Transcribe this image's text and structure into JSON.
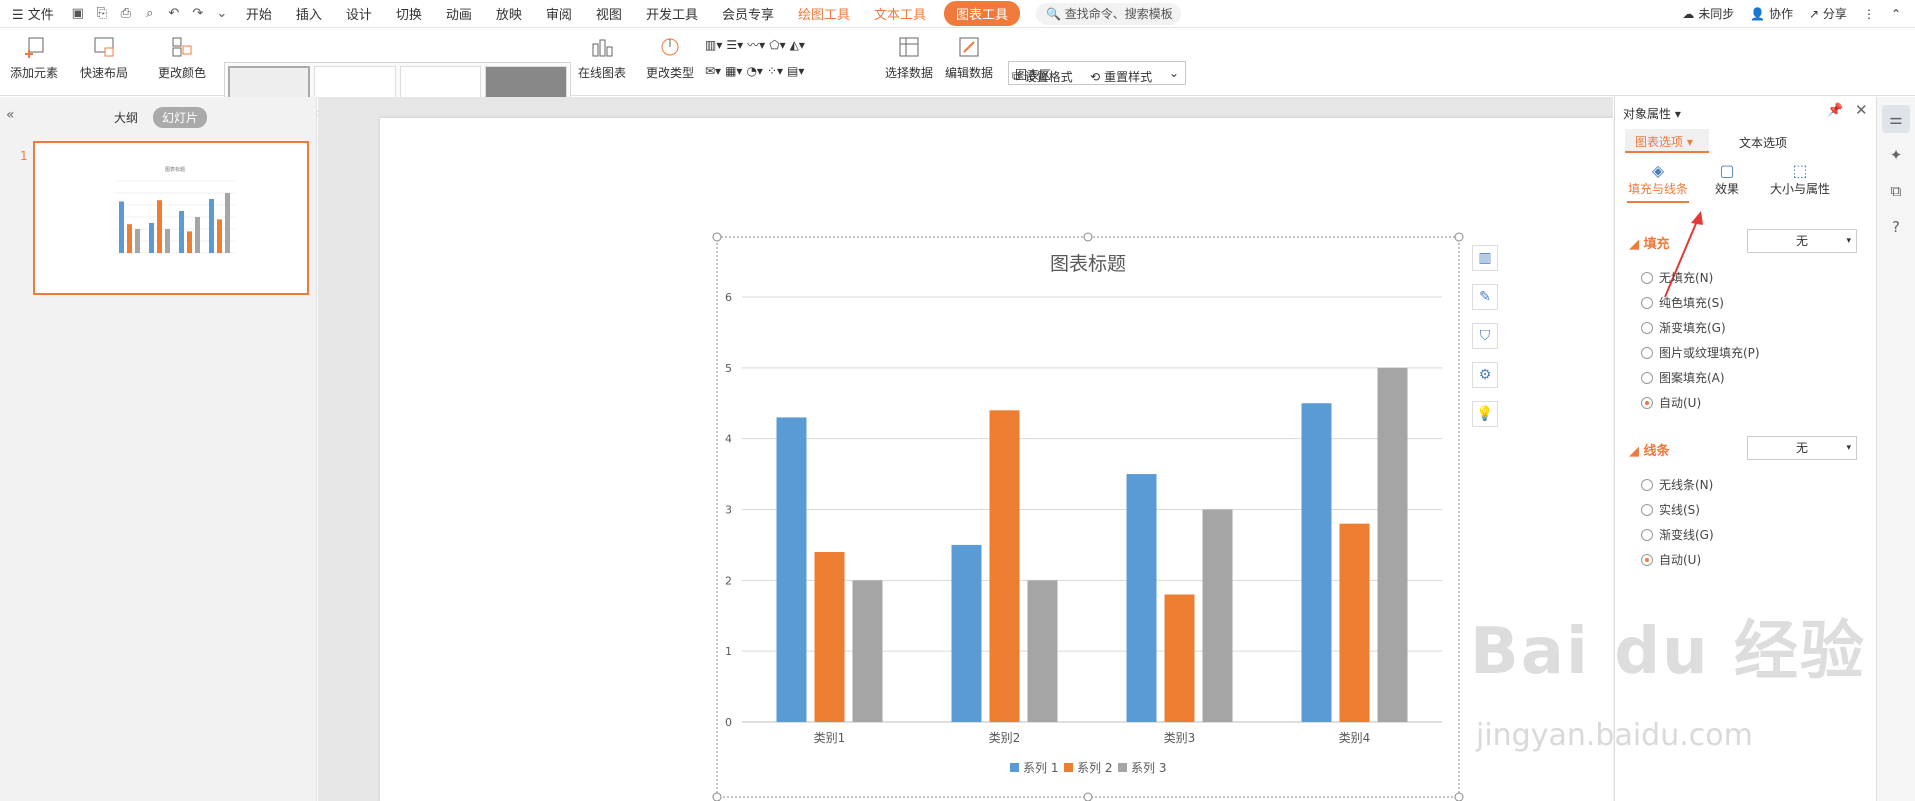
{
  "menu": {
    "file": "文件",
    "items": [
      "开始",
      "插入",
      "设计",
      "切换",
      "动画",
      "放映",
      "审阅",
      "视图",
      "开发工具",
      "会员专享"
    ],
    "context_tools": [
      "绘图工具",
      "文本工具"
    ],
    "active_tool": "图表工具",
    "search": "查找命令、搜索模板",
    "right": [
      "未同步",
      "协作",
      "分享"
    ]
  },
  "ribbon": {
    "add_element": "添加元素",
    "quick_layout": "快速布局",
    "change_color": "更改颜色",
    "online_chart": "在线图表",
    "change_type": "更改类型",
    "select_data": "选择数据",
    "edit_data": "编辑数据",
    "area_select": "图表区",
    "set_format": "设置格式",
    "reset_style": "重置样式"
  },
  "left": {
    "outline": "大纲",
    "slides": "幻灯片",
    "slide_number": "1"
  },
  "chart_data": {
    "type": "bar",
    "title": "图表标题",
    "categories": [
      "类别1",
      "类别2",
      "类别3",
      "类别4"
    ],
    "series": [
      {
        "name": "系列 1",
        "values": [
          4.3,
          2.5,
          3.5,
          4.5
        ],
        "color": "#5b9bd5"
      },
      {
        "name": "系列 2",
        "values": [
          2.4,
          4.4,
          1.8,
          2.8
        ],
        "color": "#ed7d31"
      },
      {
        "name": "系列 3",
        "values": [
          2,
          2,
          3,
          5
        ],
        "color": "#a5a5a5"
      }
    ],
    "ylim": [
      0,
      6
    ],
    "yticks": [
      "0",
      "1",
      "2",
      "3",
      "4",
      "5",
      "6"
    ],
    "grid": true,
    "legend": "bottom"
  },
  "panel": {
    "title": "对象属性",
    "tab_chart": "图表选项",
    "tab_text": "文本选项",
    "sub_fill": "填充与线条",
    "sub_effect": "效果",
    "sub_size": "大小与属性",
    "fill_head": "填充",
    "fill_value": "无",
    "fill_options": [
      "无填充(N)",
      "纯色填充(S)",
      "渐变填充(G)",
      "图片或纹理填充(P)",
      "图案填充(A)",
      "自动(U)"
    ],
    "line_head": "线条",
    "line_value": "无",
    "line_options": [
      "无线条(N)",
      "实线(S)",
      "渐变线(G)",
      "自动(U)"
    ]
  },
  "watermark": {
    "main": "Bai du 经验",
    "sub": "jingyan.baidu.com"
  }
}
